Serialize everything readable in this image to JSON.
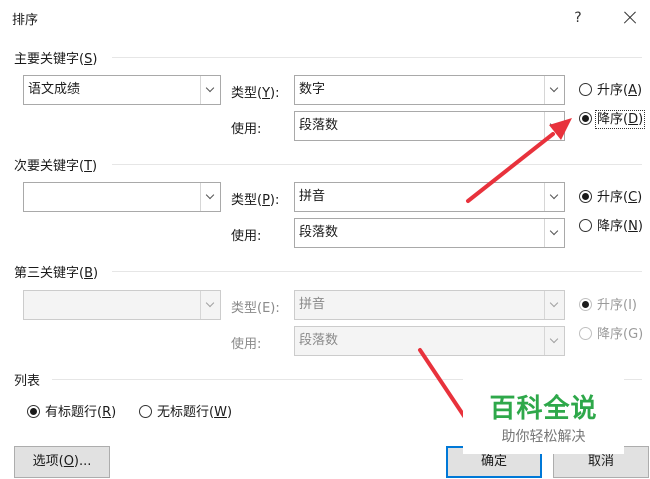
{
  "dialog": {
    "title": "排序",
    "help_label": "?"
  },
  "primary": {
    "label": "主要关键字(",
    "label_key": "S",
    "column_value": "语文成绩",
    "type_label": "类型(",
    "type_key": "Y",
    "type_value": "数字",
    "use_label": "使用:",
    "use_value": "段落数",
    "asc_label": "升序(",
    "asc_key": "A",
    "desc_label": "降序(",
    "desc_key": "D",
    "selected": "desc"
  },
  "secondary": {
    "label": "次要关键字(",
    "label_key": "T",
    "column_value": "",
    "type_label": "类型(",
    "type_key": "P",
    "type_value": "拼音",
    "use_label": "使用:",
    "use_value": "段落数",
    "asc_label": "升序(",
    "asc_key": "C",
    "desc_label": "降序(",
    "desc_key": "N",
    "selected": "asc"
  },
  "tertiary": {
    "label": "第三关键字(",
    "label_key": "B",
    "column_value": "",
    "type_label": "类型(E):",
    "type_value": "拼音",
    "use_label": "使用:",
    "use_value": "段落数",
    "asc_label": "升序(I)",
    "desc_label": "降序(G)",
    "selected": "asc",
    "disabled": true
  },
  "list": {
    "label": "列表",
    "header_row_label": "有标题行(",
    "header_row_key": "R",
    "no_header_row_label": "无标题行(",
    "no_header_row_key": "W",
    "selected": "header"
  },
  "buttons": {
    "options_label": "选项(",
    "options_key": "O",
    "options_suffix": ")...",
    "ok_label": "确定",
    "cancel_label": "取消"
  },
  "watermark": {
    "main": "百科全说",
    "sub": "助你轻松解决"
  },
  "colors": {
    "accent": "#0078d7",
    "arrow": "#e8323c",
    "watermark": "#2ea84a"
  }
}
